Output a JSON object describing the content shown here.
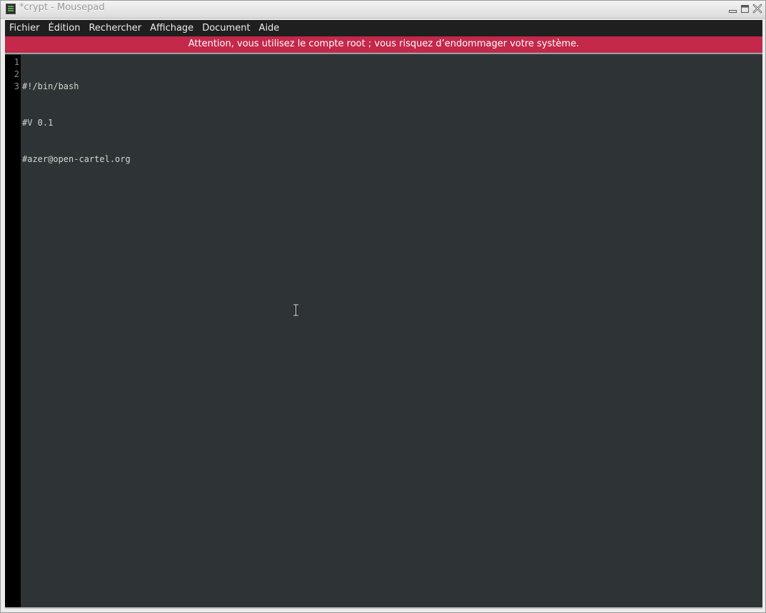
{
  "window": {
    "title": "*crypt - Mousepad",
    "controls": {
      "minimize_icon": "minimize-icon",
      "maximize_icon": "maximize-icon",
      "close_icon": "close-icon"
    }
  },
  "menu": {
    "items": [
      "Fichier",
      "Édition",
      "Rechercher",
      "Affichage",
      "Document",
      "Aide"
    ]
  },
  "warning": {
    "text": "Attention, vous utilisez le compte root ; vous risquez d’endommager votre système."
  },
  "editor": {
    "line_numbers": [
      "1",
      "2",
      "3"
    ],
    "lines": [
      "#!/bin/bash",
      "#V 0.1",
      "#azer@open-cartel.org"
    ]
  },
  "colors": {
    "warning_bg": "#c4284a",
    "editor_bg": "#2e3436",
    "menubar_bg": "#1f1f1f",
    "gutter_bg": "#000000"
  }
}
